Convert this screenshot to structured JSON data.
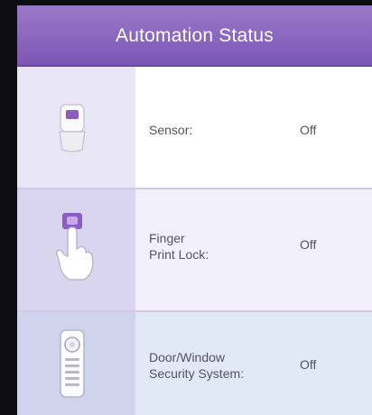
{
  "header": {
    "title": "Automation Status"
  },
  "devices": [
    {
      "label_line1": "Sensor:",
      "label_line2": "",
      "value": "Off",
      "icon": "motion-sensor-icon"
    },
    {
      "label_line1": "Finger",
      "label_line2": "Print Lock:",
      "value": "Off",
      "icon": "fingerprint-lock-icon"
    },
    {
      "label_line1": "Door/Window",
      "label_line2": "Security System:",
      "value": "Off",
      "icon": "keypad-remote-icon"
    }
  ],
  "colors": {
    "header": "#8a66c0",
    "icon_accent": "#8a5cc4"
  }
}
